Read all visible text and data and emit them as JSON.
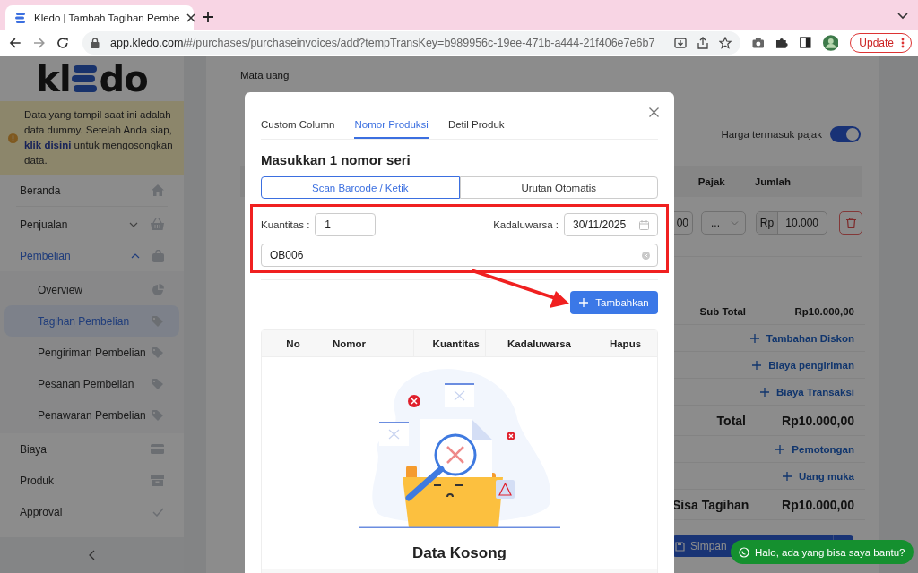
{
  "browser": {
    "tab_title": "Kledo | Tambah Tagihan Pembe",
    "url": {
      "host": "app.kledo.com",
      "path": "/#/purchases/purchaseinvoices/add?tempTransKey=b989956c-19ee-471b-a444-21f406e7e6b7"
    },
    "update_button": "Update"
  },
  "sidebar": {
    "logo": {
      "left": "kl",
      "right": "do"
    },
    "notice": {
      "before": "Data yang tampil saat ini adalah data dummy. Setelah Anda siap,",
      "link": "klik disini",
      "after": "untuk mengosongkan data."
    },
    "nav": [
      {
        "label": "Beranda",
        "selected": false
      },
      {
        "label": "Penjualan",
        "selected": false,
        "expanded": false
      },
      {
        "label": "Pembelian",
        "selected": true,
        "expanded": true,
        "children": [
          {
            "label": "Overview",
            "selected": false
          },
          {
            "label": "Tagihan Pembelian",
            "selected": true
          },
          {
            "label": "Pengiriman Pembelian",
            "selected": false
          },
          {
            "label": "Pesanan Pembelian",
            "selected": false
          },
          {
            "label": "Penawaran Pembelian",
            "selected": false
          }
        ]
      },
      {
        "label": "Biaya",
        "selected": false
      },
      {
        "label": "Produk",
        "selected": false
      },
      {
        "label": "Approval",
        "selected": false
      }
    ]
  },
  "form": {
    "currency_label": "Mata uang",
    "tax_inclusive": {
      "label": "Harga termasuk pajak",
      "on": true
    },
    "columns": [
      "Pajak",
      "Jumlah"
    ],
    "item": {
      "amount_tail": "00",
      "tax": "...",
      "currency": "Rp",
      "total": "10.000"
    },
    "summary": [
      {
        "kind": "subtotal",
        "label": "Sub Total",
        "value": "Rp10.000,00"
      },
      {
        "kind": "link",
        "label": "Tambahan Diskon"
      },
      {
        "kind": "link",
        "label": "Biaya pengiriman"
      },
      {
        "kind": "link",
        "label": "Biaya Transaksi"
      },
      {
        "kind": "total",
        "label": "Total",
        "value": "Rp10.000,00"
      },
      {
        "kind": "link",
        "label": "Pemotongan"
      },
      {
        "kind": "link",
        "label": "Uang muka"
      },
      {
        "kind": "total",
        "label": "Sisa Tagihan",
        "value": "Rp10.000,00"
      }
    ],
    "save_button": "Simpan"
  },
  "modal": {
    "tabs": [
      {
        "label": "Custom Column",
        "selected": false
      },
      {
        "label": "Nomor Produksi",
        "selected": true
      },
      {
        "label": "Detil Produk",
        "selected": false
      }
    ],
    "heading": "Masukkan 1 nomor seri",
    "modes": [
      {
        "label": "Scan Barcode / Ketik",
        "selected": true
      },
      {
        "label": "Urutan Otomatis",
        "selected": false
      }
    ],
    "quantity": {
      "label": "Kuantitas :",
      "value": "1"
    },
    "expiry": {
      "label": "Kadaluwarsa :",
      "value": "30/11/2025"
    },
    "serial": {
      "value": "OB006"
    },
    "add_button": "Tambahkan",
    "table": {
      "columns": [
        "No",
        "Nomor",
        "Kuantitas",
        "Kadaluwarsa",
        "Hapus"
      ]
    },
    "empty_text": "Data Kosong"
  },
  "chat_button": "Halo, ada yang bisa saya bantu?"
}
